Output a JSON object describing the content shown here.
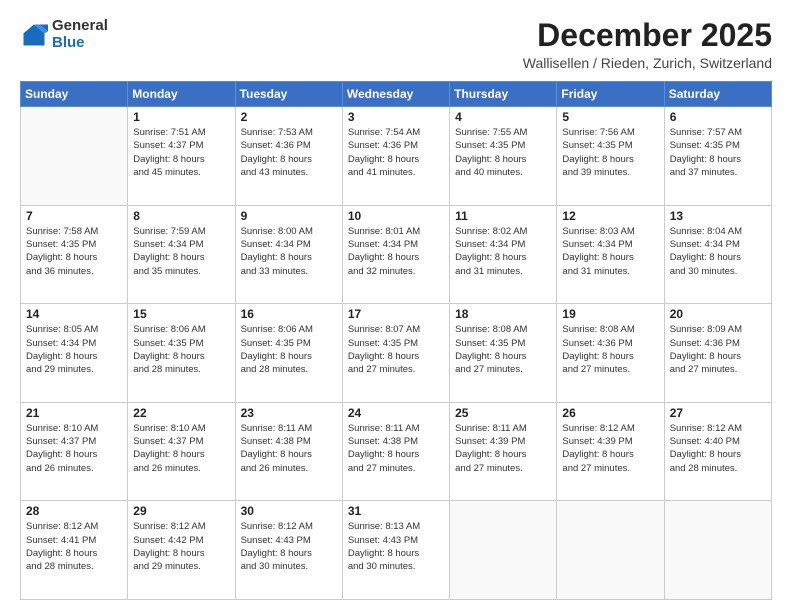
{
  "logo": {
    "general": "General",
    "blue": "Blue"
  },
  "header": {
    "month_title": "December 2025",
    "location": "Wallisellen / Rieden, Zurich, Switzerland"
  },
  "days_of_week": [
    "Sunday",
    "Monday",
    "Tuesday",
    "Wednesday",
    "Thursday",
    "Friday",
    "Saturday"
  ],
  "weeks": [
    [
      {
        "day": "",
        "content": ""
      },
      {
        "day": "1",
        "content": "Sunrise: 7:51 AM\nSunset: 4:37 PM\nDaylight: 8 hours\nand 45 minutes."
      },
      {
        "day": "2",
        "content": "Sunrise: 7:53 AM\nSunset: 4:36 PM\nDaylight: 8 hours\nand 43 minutes."
      },
      {
        "day": "3",
        "content": "Sunrise: 7:54 AM\nSunset: 4:36 PM\nDaylight: 8 hours\nand 41 minutes."
      },
      {
        "day": "4",
        "content": "Sunrise: 7:55 AM\nSunset: 4:35 PM\nDaylight: 8 hours\nand 40 minutes."
      },
      {
        "day": "5",
        "content": "Sunrise: 7:56 AM\nSunset: 4:35 PM\nDaylight: 8 hours\nand 39 minutes."
      },
      {
        "day": "6",
        "content": "Sunrise: 7:57 AM\nSunset: 4:35 PM\nDaylight: 8 hours\nand 37 minutes."
      }
    ],
    [
      {
        "day": "7",
        "content": "Sunrise: 7:58 AM\nSunset: 4:35 PM\nDaylight: 8 hours\nand 36 minutes."
      },
      {
        "day": "8",
        "content": "Sunrise: 7:59 AM\nSunset: 4:34 PM\nDaylight: 8 hours\nand 35 minutes."
      },
      {
        "day": "9",
        "content": "Sunrise: 8:00 AM\nSunset: 4:34 PM\nDaylight: 8 hours\nand 33 minutes."
      },
      {
        "day": "10",
        "content": "Sunrise: 8:01 AM\nSunset: 4:34 PM\nDaylight: 8 hours\nand 32 minutes."
      },
      {
        "day": "11",
        "content": "Sunrise: 8:02 AM\nSunset: 4:34 PM\nDaylight: 8 hours\nand 31 minutes."
      },
      {
        "day": "12",
        "content": "Sunrise: 8:03 AM\nSunset: 4:34 PM\nDaylight: 8 hours\nand 31 minutes."
      },
      {
        "day": "13",
        "content": "Sunrise: 8:04 AM\nSunset: 4:34 PM\nDaylight: 8 hours\nand 30 minutes."
      }
    ],
    [
      {
        "day": "14",
        "content": "Sunrise: 8:05 AM\nSunset: 4:34 PM\nDaylight: 8 hours\nand 29 minutes."
      },
      {
        "day": "15",
        "content": "Sunrise: 8:06 AM\nSunset: 4:35 PM\nDaylight: 8 hours\nand 28 minutes."
      },
      {
        "day": "16",
        "content": "Sunrise: 8:06 AM\nSunset: 4:35 PM\nDaylight: 8 hours\nand 28 minutes."
      },
      {
        "day": "17",
        "content": "Sunrise: 8:07 AM\nSunset: 4:35 PM\nDaylight: 8 hours\nand 27 minutes."
      },
      {
        "day": "18",
        "content": "Sunrise: 8:08 AM\nSunset: 4:35 PM\nDaylight: 8 hours\nand 27 minutes."
      },
      {
        "day": "19",
        "content": "Sunrise: 8:08 AM\nSunset: 4:36 PM\nDaylight: 8 hours\nand 27 minutes."
      },
      {
        "day": "20",
        "content": "Sunrise: 8:09 AM\nSunset: 4:36 PM\nDaylight: 8 hours\nand 27 minutes."
      }
    ],
    [
      {
        "day": "21",
        "content": "Sunrise: 8:10 AM\nSunset: 4:37 PM\nDaylight: 8 hours\nand 26 minutes."
      },
      {
        "day": "22",
        "content": "Sunrise: 8:10 AM\nSunset: 4:37 PM\nDaylight: 8 hours\nand 26 minutes."
      },
      {
        "day": "23",
        "content": "Sunrise: 8:11 AM\nSunset: 4:38 PM\nDaylight: 8 hours\nand 26 minutes."
      },
      {
        "day": "24",
        "content": "Sunrise: 8:11 AM\nSunset: 4:38 PM\nDaylight: 8 hours\nand 27 minutes."
      },
      {
        "day": "25",
        "content": "Sunrise: 8:11 AM\nSunset: 4:39 PM\nDaylight: 8 hours\nand 27 minutes."
      },
      {
        "day": "26",
        "content": "Sunrise: 8:12 AM\nSunset: 4:39 PM\nDaylight: 8 hours\nand 27 minutes."
      },
      {
        "day": "27",
        "content": "Sunrise: 8:12 AM\nSunset: 4:40 PM\nDaylight: 8 hours\nand 28 minutes."
      }
    ],
    [
      {
        "day": "28",
        "content": "Sunrise: 8:12 AM\nSunset: 4:41 PM\nDaylight: 8 hours\nand 28 minutes."
      },
      {
        "day": "29",
        "content": "Sunrise: 8:12 AM\nSunset: 4:42 PM\nDaylight: 8 hours\nand 29 minutes."
      },
      {
        "day": "30",
        "content": "Sunrise: 8:12 AM\nSunset: 4:43 PM\nDaylight: 8 hours\nand 30 minutes."
      },
      {
        "day": "31",
        "content": "Sunrise: 8:13 AM\nSunset: 4:43 PM\nDaylight: 8 hours\nand 30 minutes."
      },
      {
        "day": "",
        "content": ""
      },
      {
        "day": "",
        "content": ""
      },
      {
        "day": "",
        "content": ""
      }
    ]
  ]
}
